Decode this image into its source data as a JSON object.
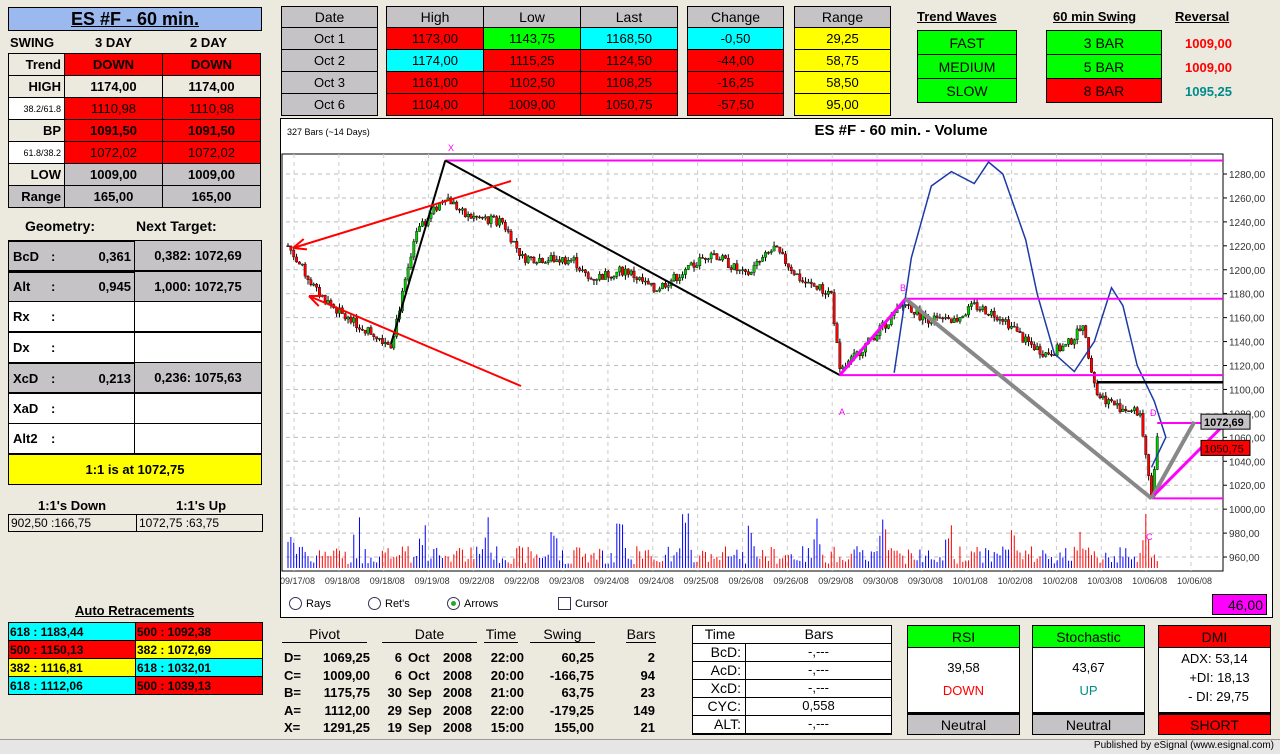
{
  "title": "ES #F - 60 min.",
  "swing": {
    "label": "SWING",
    "col1": "3 DAY",
    "col2": "2 DAY",
    "rows": [
      {
        "label": "Trend",
        "v1": "DOWN",
        "v2": "DOWN"
      },
      {
        "label": "HIGH",
        "v1": "1174,00",
        "v2": "1174,00"
      },
      {
        "label": "38.2/61.8",
        "v1": "1110,98",
        "v2": "1110,98"
      },
      {
        "label": "BP",
        "v1": "1091,50",
        "v2": "1091,50"
      },
      {
        "label": "61.8/38.2",
        "v1": "1072,02",
        "v2": "1072,02"
      },
      {
        "label": "LOW",
        "v1": "1009,00",
        "v2": "1009,00"
      },
      {
        "label": "Range",
        "v1": "165,00",
        "v2": "165,00"
      }
    ]
  },
  "geometry": {
    "label": "Geometry:",
    "next_label": "Next Target:",
    "rows": [
      {
        "label": "BcD",
        "sep": ":",
        "value": "0,361",
        "target": "0,382: 1072,69"
      },
      {
        "label": "Alt",
        "sep": ":",
        "value": "0,945",
        "target": "1,000: 1072,75"
      },
      {
        "label": "Rx",
        "sep": ":",
        "value": "",
        "target": ""
      },
      {
        "label": "Dx",
        "sep": ":",
        "value": "",
        "target": ""
      },
      {
        "label": "XcD",
        "sep": ":",
        "value": "0,213",
        "target": "0,236: 1075,63"
      },
      {
        "label": "XaD",
        "sep": ":",
        "value": "",
        "target": ""
      },
      {
        "label": "Alt2",
        "sep": ":",
        "value": "",
        "target": ""
      }
    ],
    "one_to_one": "1:1 is at 1072,75"
  },
  "ones": {
    "down_label": "1:1's Down",
    "up_label": "1:1's Up",
    "down": "902,50 :166,75",
    "up": "1072,75 :63,75"
  },
  "auto_retracements": {
    "title": "Auto Retracements",
    "cells": [
      {
        "text": "618 : 1183,44",
        "color": "#00ffff"
      },
      {
        "text": "500 : 1092,38",
        "color": "#ff0000"
      },
      {
        "text": "500 : 1150,13",
        "color": "#ff0000"
      },
      {
        "text": "382 : 1072,69",
        "color": "#ffff00"
      },
      {
        "text": "382 : 1116,81",
        "color": "#ffff00"
      },
      {
        "text": "618 : 1032,01",
        "color": "#00ffff"
      },
      {
        "text": "618 : 1112,06",
        "color": "#00ffff"
      },
      {
        "text": "500 : 1039,13",
        "color": "#ff0000"
      }
    ]
  },
  "daily": {
    "headers": [
      "Date",
      "High",
      "Low",
      "Last",
      "Change",
      "Range"
    ],
    "rows": [
      {
        "date": "Oct  1",
        "high": "1173,00",
        "low": "1143,75",
        "last": "1168,50",
        "change": "-0,50",
        "range": "29,25",
        "c": [
          "#ff0000",
          "#00ff00",
          "#00ffff",
          "#00ffff"
        ]
      },
      {
        "date": "Oct  2",
        "high": "1174,00",
        "low": "1115,25",
        "last": "1124,50",
        "change": "-44,00",
        "range": "58,75",
        "c": [
          "#00ffff",
          "#ff0000",
          "#ff0000",
          "#ff0000"
        ]
      },
      {
        "date": "Oct  3",
        "high": "1161,00",
        "low": "1102,50",
        "last": "1108,25",
        "change": "-16,25",
        "range": "58,50",
        "c": [
          "#ff0000",
          "#ff0000",
          "#ff0000",
          "#ff0000"
        ]
      },
      {
        "date": "Oct  6",
        "high": "1104,00",
        "low": "1009,00",
        "last": "1050,75",
        "change": "-57,50",
        "range": "95,00",
        "c": [
          "#ff0000",
          "#ff0000",
          "#ff0000",
          "#ff0000"
        ]
      }
    ]
  },
  "trend_waves": {
    "title": "Trend Waves",
    "items": [
      "FAST",
      "MEDIUM",
      "SLOW"
    ]
  },
  "swing60": {
    "title": "60 min Swing",
    "items": [
      {
        "label": "3 BAR",
        "color": "#00ff00"
      },
      {
        "label": "5 BAR",
        "color": "#00ff00"
      },
      {
        "label": "8 BAR",
        "color": "#ff0000"
      }
    ]
  },
  "reversal": {
    "title": "Reversal",
    "items": [
      {
        "value": "1009,00",
        "color": "#ff0000"
      },
      {
        "value": "1009,00",
        "color": "#ff0000"
      },
      {
        "value": "1095,25",
        "color": "#008b8b"
      }
    ]
  },
  "chart_controls": {
    "rays": "Rays",
    "rets": "Ret's",
    "arrows": "Arrows",
    "cursor": "Cursor",
    "selected": "Arrows",
    "volume_box": "46,00"
  },
  "chart_data": {
    "type": "candlestick",
    "title": "ES #F - 60 min. - Volume",
    "subtitle": "327 Bars (~14 Days)",
    "bars": 327,
    "ylim": [
      950,
      1295
    ],
    "yticks": [
      "1280,00",
      "1260,00",
      "1240,00",
      "1220,00",
      "1200,00",
      "1180,00",
      "1160,00",
      "1140,00",
      "1120,00",
      "1100,00",
      "1080,00",
      "1060,00",
      "1040,00",
      "1020,00",
      "1000,00",
      "980,00",
      "960,00"
    ],
    "ytick_values": [
      1280,
      1260,
      1240,
      1220,
      1200,
      1180,
      1160,
      1140,
      1120,
      1100,
      1080,
      1060,
      1040,
      1020,
      1000,
      980,
      960
    ],
    "xticks": [
      "09/17/08",
      "09/18/08",
      "09/18/08",
      "09/19/08",
      "09/22/08",
      "09/22/08",
      "09/23/08",
      "09/24/08",
      "09/24/08",
      "09/25/08",
      "09/26/08",
      "09/26/08",
      "09/29/08",
      "09/30/08",
      "09/30/08",
      "10/01/08",
      "10/02/08",
      "10/02/08",
      "10/03/08",
      "10/06/08",
      "10/06/08"
    ],
    "price_path": [
      [
        0,
        1220
      ],
      [
        10,
        1182
      ],
      [
        20,
        1160
      ],
      [
        36,
        1138
      ],
      [
        45,
        1230
      ],
      [
        55,
        1262
      ],
      [
        62,
        1245
      ],
      [
        75,
        1240
      ],
      [
        82,
        1210
      ],
      [
        100,
        1208
      ],
      [
        105,
        1192
      ],
      [
        118,
        1200
      ],
      [
        128,
        1183
      ],
      [
        140,
        1200
      ],
      [
        148,
        1215
      ],
      [
        160,
        1195
      ],
      [
        170,
        1218
      ],
      [
        180,
        1190
      ],
      [
        190,
        1180
      ],
      [
        193,
        1114
      ],
      [
        205,
        1145
      ],
      [
        216,
        1172
      ],
      [
        222,
        1160
      ],
      [
        232,
        1156
      ],
      [
        240,
        1170
      ],
      [
        250,
        1160
      ],
      [
        258,
        1140
      ],
      [
        265,
        1130
      ],
      [
        272,
        1136
      ],
      [
        278,
        1152
      ],
      [
        283,
        1096
      ],
      [
        290,
        1086
      ],
      [
        298,
        1080
      ],
      [
        302,
        1012
      ],
      [
        304,
        1060
      ]
    ],
    "volume_overlay": [
      [
        212,
        1114
      ],
      [
        218,
        1210
      ],
      [
        225,
        1270
      ],
      [
        232,
        1282
      ],
      [
        240,
        1272
      ],
      [
        245,
        1290
      ],
      [
        250,
        1280
      ],
      [
        258,
        1225
      ],
      [
        262,
        1180
      ],
      [
        268,
        1130
      ],
      [
        275,
        1115
      ],
      [
        282,
        1140
      ],
      [
        288,
        1185
      ],
      [
        292,
        1170
      ],
      [
        297,
        1120
      ],
      [
        303,
        1090
      ],
      [
        307,
        1060
      ],
      [
        302,
        1035
      ]
    ],
    "pivots": [
      {
        "name": "X",
        "bar": 55,
        "price": 1291.25
      },
      {
        "name": "A",
        "bar": 193,
        "price": 1112.0
      },
      {
        "name": "B",
        "bar": 216,
        "price": 1175.75
      },
      {
        "name": "C",
        "bar": 302,
        "price": 1009.0
      },
      {
        "name": "D",
        "bar": 304,
        "price": 1069.25
      }
    ],
    "levels": [
      1291.25,
      1175.75,
      1112.0,
      1106.0,
      1072.0,
      1009.0
    ],
    "tags": [
      {
        "text": "1072,69",
        "color": "#c6c3c6",
        "price": 1072.69
      },
      {
        "text": "1050,75",
        "color": "#ff0000",
        "price": 1050.75
      }
    ],
    "volume_label": "C"
  },
  "pivot_table": {
    "headers": [
      "Pivot",
      "Date",
      "Time",
      "Swing",
      "Bars"
    ],
    "rows": [
      {
        "p": "D=",
        "v": "1069,25",
        "d": "6",
        "m": "Oct",
        "y": "2008",
        "t": "22:00",
        "s": "60,25",
        "b": "2"
      },
      {
        "p": "C=",
        "v": "1009,00",
        "d": "6",
        "m": "Oct",
        "y": "2008",
        "t": "20:00",
        "s": "-166,75",
        "b": "94"
      },
      {
        "p": "B=",
        "v": "1175,75",
        "d": "30",
        "m": "Sep",
        "y": "2008",
        "t": "21:00",
        "s": "63,75",
        "b": "23"
      },
      {
        "p": "A=",
        "v": "1112,00",
        "d": "29",
        "m": "Sep",
        "y": "2008",
        "t": "22:00",
        "s": "-179,25",
        "b": "149"
      },
      {
        "p": "X=",
        "v": "1291,25",
        "d": "19",
        "m": "Sep",
        "y": "2008",
        "t": "15:00",
        "s": "155,00",
        "b": "21"
      }
    ]
  },
  "time_bars": {
    "h1": "Time",
    "h2": "Bars",
    "rows": [
      {
        "l": "BcD:",
        "v": "-,---"
      },
      {
        "l": "AcD:",
        "v": "-,---"
      },
      {
        "l": "XcD:",
        "v": "-,---"
      },
      {
        "l": "CYC:",
        "v": "0,558"
      },
      {
        "l": "ALT:",
        "v": "-,---"
      }
    ]
  },
  "rsi": {
    "title": "RSI",
    "value": "39,58",
    "dir": "DOWN",
    "status": "Neutral"
  },
  "stoch": {
    "title": "Stochastic",
    "value": "43,67",
    "dir": "UP",
    "status": "Neutral"
  },
  "dmi": {
    "title": "DMI",
    "adx": "ADX:  53,14",
    "pdi": "+DI:  18,13",
    "mdi": "- DI:  29,75",
    "status": "SHORT"
  },
  "footer": "Published by eSignal (www.esignal.com)"
}
